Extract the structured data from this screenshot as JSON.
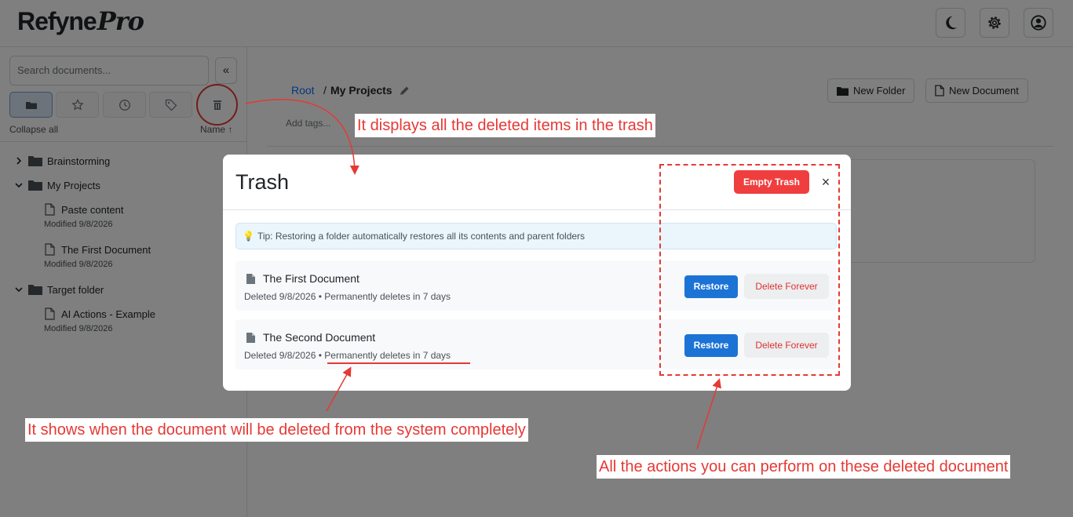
{
  "app": {
    "logo_main": "Refyne",
    "logo_accent": "Pro"
  },
  "header": {
    "icons": [
      "moon-icon",
      "gear-icon",
      "user-icon"
    ]
  },
  "sidebar": {
    "search_placeholder": "Search documents...",
    "collapse_glyph": "«",
    "tabs": [
      "folder-icon",
      "star-icon",
      "clock-icon",
      "tag-icon",
      "trash-icon"
    ],
    "collapse_all": "Collapse all",
    "sort_label": "Name ↑",
    "tree": [
      {
        "type": "folder",
        "label": "Brainstorming",
        "expanded": false
      },
      {
        "type": "folder",
        "label": "My Projects",
        "expanded": true
      },
      {
        "type": "document",
        "label": "Paste content",
        "modified": "Modified 9/8/2026"
      },
      {
        "type": "document",
        "label": "The First Document",
        "modified": "Modified 9/8/2026"
      },
      {
        "type": "folder",
        "label": "Target folder",
        "expanded": true
      },
      {
        "type": "document",
        "label": "AI Actions - Example",
        "modified": "Modified 9/8/2026"
      }
    ]
  },
  "main": {
    "breadcrumb_root": "Root",
    "breadcrumb_sep": "/",
    "breadcrumb_current": "My Projects",
    "add_tags_placeholder": "Add tags...",
    "new_folder_label": "New Folder",
    "new_document_label": "New Document"
  },
  "modal": {
    "title": "Trash",
    "empty_trash_label": "Empty Trash",
    "close_glyph": "×",
    "tip_text": "Tip: Restoring a folder automatically restores all its contents and parent folders",
    "items": [
      {
        "title": "The First Document",
        "deleted": "Deleted 9/8/2026",
        "sep": "•",
        "retention": "Permanently deletes in 7 days",
        "restore_label": "Restore",
        "delete_label": "Delete Forever"
      },
      {
        "title": "The Second Document",
        "deleted": "Deleted 9/8/2026",
        "sep": "•",
        "retention": "Permanently deletes in 7 days",
        "restore_label": "Restore",
        "delete_label": "Delete Forever"
      }
    ]
  },
  "annotations": {
    "trash_callout": "It displays all the deleted items in the trash",
    "deletion_callout": "It shows when the document will be deleted from the system completely",
    "actions_callout": "All the actions you can perform on these deleted document",
    "color": "#e53935"
  },
  "colors": {
    "primary": "#1c73d6",
    "danger": "#f03e3e",
    "link": "#0d6efd"
  }
}
